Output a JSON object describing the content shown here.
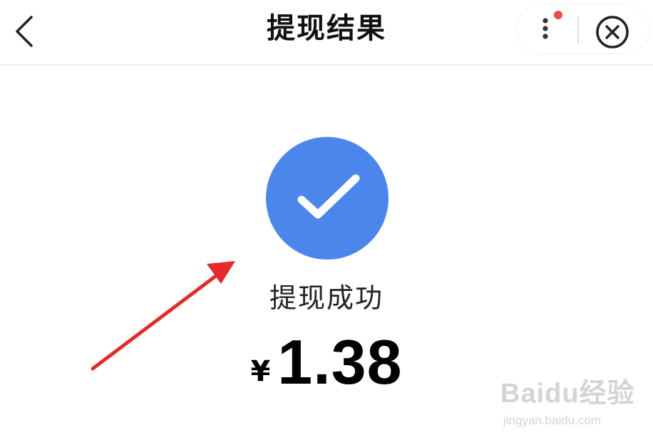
{
  "header": {
    "title": "提现结果",
    "back_icon": "chevron-left-icon",
    "more_icon": "vertical-dots-icon",
    "notification_dot_color": "#f04a46",
    "close_icon": "close-circle-icon"
  },
  "result": {
    "icon": "check-circle-icon",
    "icon_color": "#4a86ec",
    "status": "提现成功",
    "currency_symbol": "¥",
    "amount": "1.38"
  },
  "annotation": {
    "arrow_color": "#e52a2a"
  },
  "watermark": {
    "logo_text": "Baidu经验",
    "url": "jingyan.baidu.com"
  }
}
